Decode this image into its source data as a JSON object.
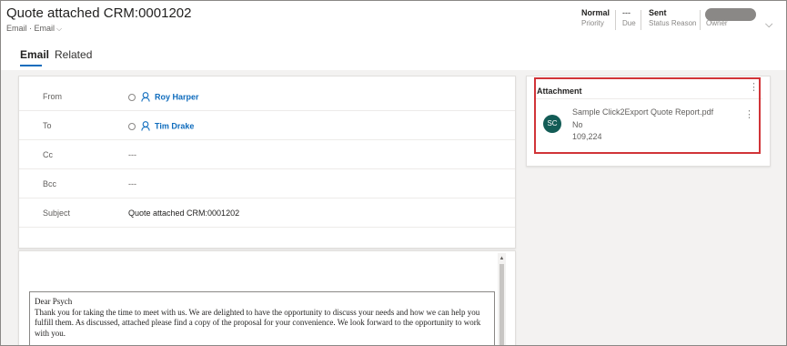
{
  "header": {
    "title": "Quote attached CRM:0001202",
    "entity": "Email",
    "form": "Email",
    "fields": [
      {
        "value": "Normal",
        "label": "Priority"
      },
      {
        "value": "---",
        "label": "Due"
      },
      {
        "value": "Sent",
        "label": "Status Reason"
      },
      {
        "value": "",
        "label": "Owner"
      }
    ]
  },
  "tabs": [
    {
      "label": "Email",
      "active": true
    },
    {
      "label": "Related",
      "active": false
    }
  ],
  "form": {
    "from": {
      "label": "From",
      "value": "Roy Harper"
    },
    "to": {
      "label": "To",
      "value": "Tim Drake"
    },
    "cc": {
      "label": "Cc",
      "value": "---"
    },
    "bcc": {
      "label": "Bcc",
      "value": "---"
    },
    "subject": {
      "label": "Subject",
      "value": "Quote attached CRM:0001202"
    }
  },
  "email_body": {
    "greeting": "Dear Psych",
    "text": "Thank you for taking the time to meet with us. We are delighted to have the opportunity to discuss your needs and how we can help you fulfill them. As discussed, attached please find a copy of the proposal for your convenience. We look forward to the opportunity to work with you."
  },
  "attachment": {
    "title": "Attachment",
    "initials": "SC",
    "filename": "Sample Click2Export Quote Report.pdf",
    "line2": "No",
    "line3": "109,224"
  },
  "colors": {
    "accent": "#0f6cbd",
    "highlight": "#d13438",
    "avatar": "#135c56"
  }
}
